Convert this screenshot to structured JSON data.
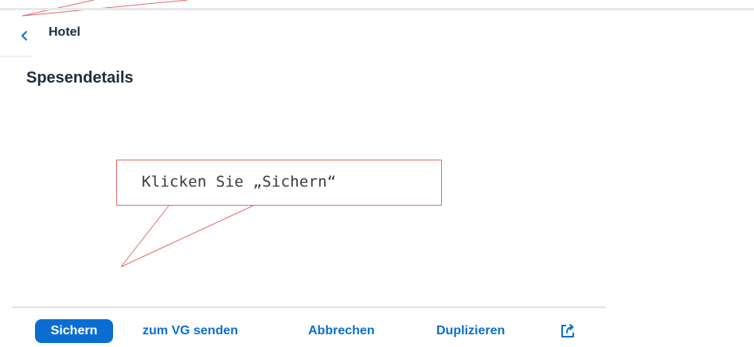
{
  "nav": {
    "back_icon": "chevron-left-icon",
    "title": "Hotel"
  },
  "header": {
    "title": "Spesendetails"
  },
  "callout": {
    "text": "Klicken Sie „Sichern“",
    "border_color": "#e06a6a"
  },
  "footer": {
    "save_label": "Sichern",
    "send_label": "zum VG senden",
    "cancel_label": "Abbrechen",
    "duplicate_label": "Duplizieren",
    "share_icon": "share-icon"
  },
  "colors": {
    "accent": "#0a6ed1",
    "text": "#1d2d3e",
    "annotation": "#e06a6a"
  }
}
